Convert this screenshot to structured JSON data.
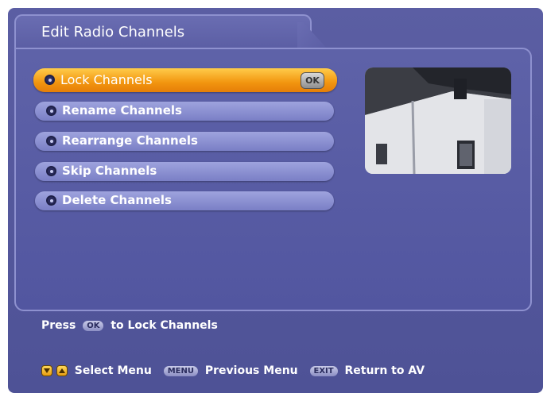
{
  "header": {
    "title": "Edit Radio Channels"
  },
  "menu": {
    "items": [
      {
        "label": "Lock Channels",
        "selected": true
      },
      {
        "label": "Rename Channels",
        "selected": false
      },
      {
        "label": "Rearrange Channels",
        "selected": false
      },
      {
        "label": "Skip Channels",
        "selected": false
      },
      {
        "label": "Delete Channels",
        "selected": false
      }
    ],
    "ok_badge": "OK"
  },
  "hint": {
    "press": "Press",
    "ok_key": "OK",
    "action": "to Lock Channels"
  },
  "footer": {
    "select_menu": "Select Menu",
    "menu_key": "MENU",
    "previous_menu": "Previous Menu",
    "exit_key": "EXIT",
    "return_av": "Return to AV"
  },
  "colors": {
    "background": "#5b5ea3",
    "selected_accent": "#f2950f",
    "item_bar": "#8e93d4"
  },
  "icons": {
    "item_bullet": "radio-dot-icon",
    "nav": "up-down-arrow-icon"
  }
}
